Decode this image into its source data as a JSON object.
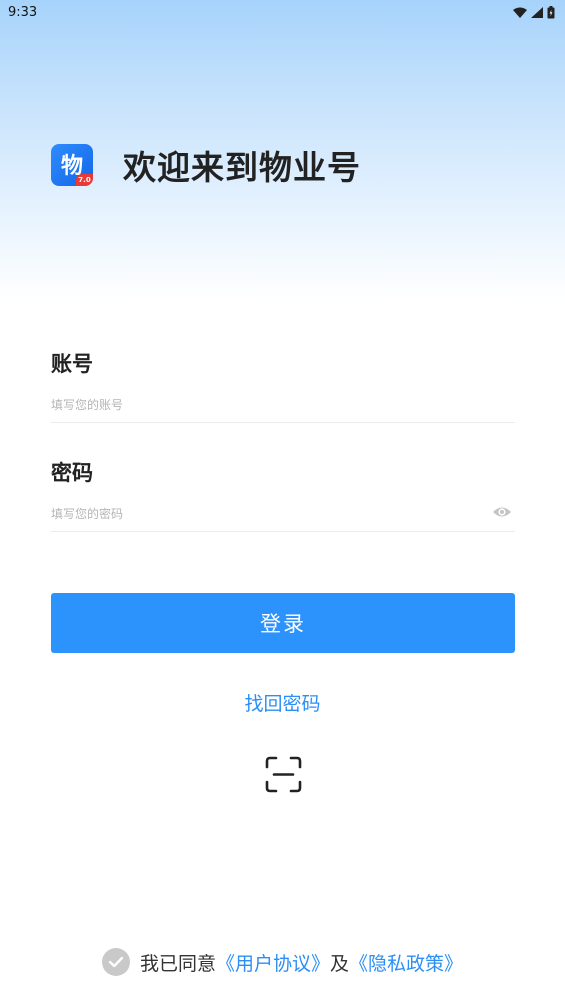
{
  "status_bar": {
    "time": "9:33",
    "icons": [
      "wifi-icon",
      "signal-icon",
      "battery-icon"
    ]
  },
  "brand": {
    "logo_char": "物",
    "logo_badge": "7.0",
    "welcome_title": "欢迎来到物业号"
  },
  "form": {
    "account_label": "账号",
    "account_placeholder": "填写您的账号",
    "account_value": "",
    "password_label": "密码",
    "password_placeholder": "填写您的密码",
    "password_value": "",
    "password_toggle_icon": "eye-icon"
  },
  "actions": {
    "login_label": "登录",
    "recover_label": "找回密码",
    "scan_icon": "scan-icon"
  },
  "agreement": {
    "checked": false,
    "prefix": "我已同意",
    "user_agreement": "《用户协议》",
    "conjunction": "及",
    "privacy_policy": "《隐私政策》"
  },
  "colors": {
    "accent": "#2b93fb",
    "link": "#2b8ff5",
    "badge": "#ea3a36"
  }
}
